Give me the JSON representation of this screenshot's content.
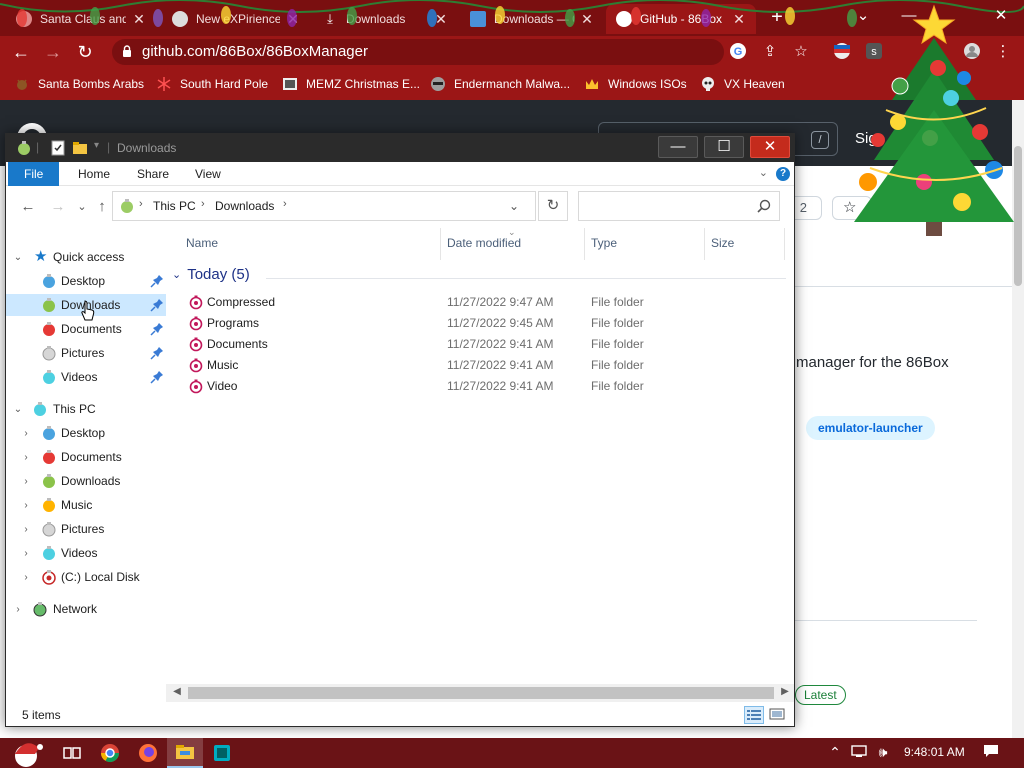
{
  "browser": {
    "tabs": [
      {
        "label": "Santa Claus and",
        "favicon_color": "#e8c0c0",
        "active": false
      },
      {
        "label": "New eXPirience",
        "favicon_color": "#d8d8d8",
        "active": false
      },
      {
        "label": "Downloads",
        "favicon_color": "#cfcfcf",
        "active": false
      },
      {
        "label": "Downloads — C",
        "favicon_color": "#4a90d9",
        "active": false
      },
      {
        "label": "GitHub - 86Box",
        "favicon_color": "#ffffff",
        "active": true
      }
    ],
    "new_tab_label": "+",
    "window_controls": {
      "minimize": "⌄",
      "restore": "—",
      "close": "✕"
    },
    "url": "github.com/86Box/86BoxManager",
    "bookmarks": [
      {
        "label": "Santa Bombs Arabs",
        "icon": "reindeer-icon"
      },
      {
        "label": "South Hard Pole",
        "icon": "snowflake-icon"
      },
      {
        "label": "MEMZ Christmas E...",
        "icon": "memz-icon"
      },
      {
        "label": "Endermanch Malwa...",
        "icon": "raccoon-icon"
      },
      {
        "label": "Windows ISOs",
        "icon": "crown-icon"
      },
      {
        "label": "VX Heaven",
        "icon": "skull-icon"
      }
    ]
  },
  "github": {
    "signin_label": "Sig",
    "search_shortcut": "/",
    "counter_label": "2",
    "star_label": "☆",
    "description_fragment": "manager for the 86Box",
    "topic_label": "emulator-launcher",
    "latest_badge": "Latest"
  },
  "explorer": {
    "title": "Downloads",
    "window_controls": {
      "minimize": "—",
      "maximize": "☐",
      "close": "✕"
    },
    "ribbon_tabs": [
      "File",
      "Home",
      "Share",
      "View"
    ],
    "help_label": "?",
    "breadcrumbs": [
      "This PC",
      "Downloads"
    ],
    "search_placeholder": "",
    "nav": {
      "quick_access_label": "Quick access",
      "quick_access": [
        {
          "label": "Desktop",
          "color": "#4aa3df"
        },
        {
          "label": "Downloads",
          "color": "#8bc34a"
        },
        {
          "label": "Documents",
          "color": "#e53935"
        },
        {
          "label": "Pictures",
          "color": "#bdbdbd"
        },
        {
          "label": "Videos",
          "color": "#4dd0e1"
        }
      ],
      "this_pc_label": "This PC",
      "this_pc": [
        {
          "label": "Desktop",
          "color": "#4aa3df"
        },
        {
          "label": "Documents",
          "color": "#e53935"
        },
        {
          "label": "Downloads",
          "color": "#8bc34a"
        },
        {
          "label": "Music",
          "color": "#ffb300"
        },
        {
          "label": "Pictures",
          "color": "#bdbdbd"
        },
        {
          "label": "Videos",
          "color": "#4dd0e1"
        },
        {
          "label": "(C:) Local Disk",
          "color": "#c62828"
        }
      ],
      "network_label": "Network"
    },
    "columns": {
      "name": "Name",
      "date": "Date modified",
      "type": "Type",
      "size": "Size"
    },
    "group_label": "Today (5)",
    "files": [
      {
        "name": "Compressed",
        "date": "11/27/2022 9:47 AM",
        "type": "File folder"
      },
      {
        "name": "Programs",
        "date": "11/27/2022 9:45 AM",
        "type": "File folder"
      },
      {
        "name": "Documents",
        "date": "11/27/2022 9:41 AM",
        "type": "File folder"
      },
      {
        "name": "Music",
        "date": "11/27/2022 9:41 AM",
        "type": "File folder"
      },
      {
        "name": "Video",
        "date": "11/27/2022 9:41 AM",
        "type": "File folder"
      }
    ],
    "status_count": "5 items"
  },
  "taskbar": {
    "clock": "9:48:01 AM"
  },
  "colors": {
    "chrome_frame": "#7a0f10",
    "chrome_toolbar": "#9b1616",
    "explorer_accent": "#1979ca",
    "selection": "#cce8ff"
  }
}
